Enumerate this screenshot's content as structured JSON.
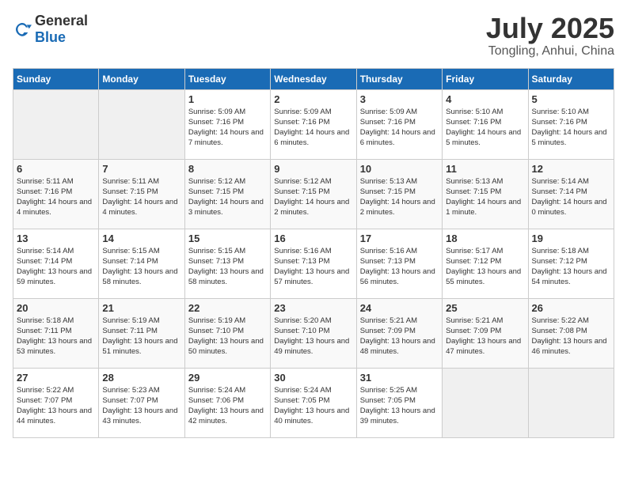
{
  "logo": {
    "general": "General",
    "blue": "Blue"
  },
  "title": "July 2025",
  "location": "Tongling, Anhui, China",
  "weekdays": [
    "Sunday",
    "Monday",
    "Tuesday",
    "Wednesday",
    "Thursday",
    "Friday",
    "Saturday"
  ],
  "weeks": [
    [
      {
        "day": "",
        "text": ""
      },
      {
        "day": "",
        "text": ""
      },
      {
        "day": "1",
        "text": "Sunrise: 5:09 AM\nSunset: 7:16 PM\nDaylight: 14 hours and 7 minutes."
      },
      {
        "day": "2",
        "text": "Sunrise: 5:09 AM\nSunset: 7:16 PM\nDaylight: 14 hours and 6 minutes."
      },
      {
        "day": "3",
        "text": "Sunrise: 5:09 AM\nSunset: 7:16 PM\nDaylight: 14 hours and 6 minutes."
      },
      {
        "day": "4",
        "text": "Sunrise: 5:10 AM\nSunset: 7:16 PM\nDaylight: 14 hours and 5 minutes."
      },
      {
        "day": "5",
        "text": "Sunrise: 5:10 AM\nSunset: 7:16 PM\nDaylight: 14 hours and 5 minutes."
      }
    ],
    [
      {
        "day": "6",
        "text": "Sunrise: 5:11 AM\nSunset: 7:16 PM\nDaylight: 14 hours and 4 minutes."
      },
      {
        "day": "7",
        "text": "Sunrise: 5:11 AM\nSunset: 7:15 PM\nDaylight: 14 hours and 4 minutes."
      },
      {
        "day": "8",
        "text": "Sunrise: 5:12 AM\nSunset: 7:15 PM\nDaylight: 14 hours and 3 minutes."
      },
      {
        "day": "9",
        "text": "Sunrise: 5:12 AM\nSunset: 7:15 PM\nDaylight: 14 hours and 2 minutes."
      },
      {
        "day": "10",
        "text": "Sunrise: 5:13 AM\nSunset: 7:15 PM\nDaylight: 14 hours and 2 minutes."
      },
      {
        "day": "11",
        "text": "Sunrise: 5:13 AM\nSunset: 7:15 PM\nDaylight: 14 hours and 1 minute."
      },
      {
        "day": "12",
        "text": "Sunrise: 5:14 AM\nSunset: 7:14 PM\nDaylight: 14 hours and 0 minutes."
      }
    ],
    [
      {
        "day": "13",
        "text": "Sunrise: 5:14 AM\nSunset: 7:14 PM\nDaylight: 13 hours and 59 minutes."
      },
      {
        "day": "14",
        "text": "Sunrise: 5:15 AM\nSunset: 7:14 PM\nDaylight: 13 hours and 58 minutes."
      },
      {
        "day": "15",
        "text": "Sunrise: 5:15 AM\nSunset: 7:13 PM\nDaylight: 13 hours and 58 minutes."
      },
      {
        "day": "16",
        "text": "Sunrise: 5:16 AM\nSunset: 7:13 PM\nDaylight: 13 hours and 57 minutes."
      },
      {
        "day": "17",
        "text": "Sunrise: 5:16 AM\nSunset: 7:13 PM\nDaylight: 13 hours and 56 minutes."
      },
      {
        "day": "18",
        "text": "Sunrise: 5:17 AM\nSunset: 7:12 PM\nDaylight: 13 hours and 55 minutes."
      },
      {
        "day": "19",
        "text": "Sunrise: 5:18 AM\nSunset: 7:12 PM\nDaylight: 13 hours and 54 minutes."
      }
    ],
    [
      {
        "day": "20",
        "text": "Sunrise: 5:18 AM\nSunset: 7:11 PM\nDaylight: 13 hours and 53 minutes."
      },
      {
        "day": "21",
        "text": "Sunrise: 5:19 AM\nSunset: 7:11 PM\nDaylight: 13 hours and 51 minutes."
      },
      {
        "day": "22",
        "text": "Sunrise: 5:19 AM\nSunset: 7:10 PM\nDaylight: 13 hours and 50 minutes."
      },
      {
        "day": "23",
        "text": "Sunrise: 5:20 AM\nSunset: 7:10 PM\nDaylight: 13 hours and 49 minutes."
      },
      {
        "day": "24",
        "text": "Sunrise: 5:21 AM\nSunset: 7:09 PM\nDaylight: 13 hours and 48 minutes."
      },
      {
        "day": "25",
        "text": "Sunrise: 5:21 AM\nSunset: 7:09 PM\nDaylight: 13 hours and 47 minutes."
      },
      {
        "day": "26",
        "text": "Sunrise: 5:22 AM\nSunset: 7:08 PM\nDaylight: 13 hours and 46 minutes."
      }
    ],
    [
      {
        "day": "27",
        "text": "Sunrise: 5:22 AM\nSunset: 7:07 PM\nDaylight: 13 hours and 44 minutes."
      },
      {
        "day": "28",
        "text": "Sunrise: 5:23 AM\nSunset: 7:07 PM\nDaylight: 13 hours and 43 minutes."
      },
      {
        "day": "29",
        "text": "Sunrise: 5:24 AM\nSunset: 7:06 PM\nDaylight: 13 hours and 42 minutes."
      },
      {
        "day": "30",
        "text": "Sunrise: 5:24 AM\nSunset: 7:05 PM\nDaylight: 13 hours and 40 minutes."
      },
      {
        "day": "31",
        "text": "Sunrise: 5:25 AM\nSunset: 7:05 PM\nDaylight: 13 hours and 39 minutes."
      },
      {
        "day": "",
        "text": ""
      },
      {
        "day": "",
        "text": ""
      }
    ]
  ]
}
